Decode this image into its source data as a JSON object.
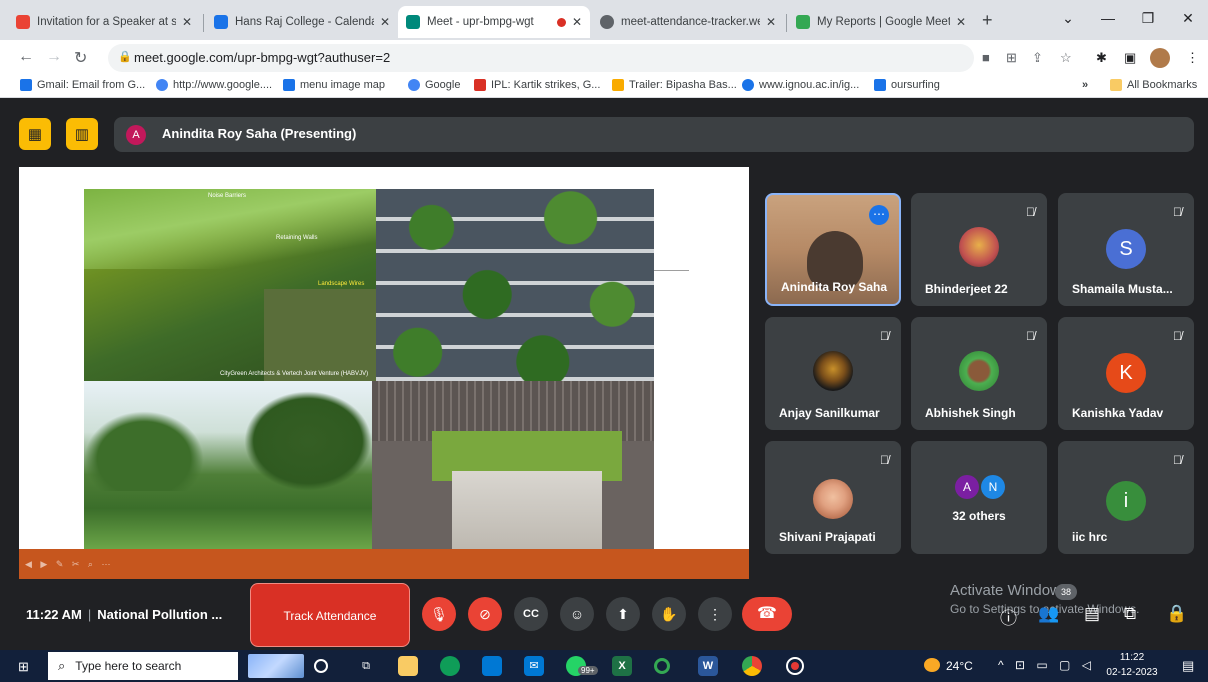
{
  "browser": {
    "tabs": [
      {
        "title": "Invitation for a Speaker at s",
        "favicon_color": "#ea4335",
        "icon": "gmail-icon"
      },
      {
        "title": "Hans Raj College - Calendar",
        "favicon_color": "#1a73e8",
        "icon": "calendar-icon"
      },
      {
        "title": "Meet - upr-bmpg-wgt",
        "favicon_color": "#00897b",
        "icon": "meet-icon",
        "active": true
      },
      {
        "title": "meet-attendance-tracker.we",
        "favicon_color": "#5f6368",
        "icon": "extension-icon"
      },
      {
        "title": "My Reports | Google Meet A",
        "favicon_color": "#34a853",
        "icon": "check-icon"
      }
    ],
    "url": "meet.google.com/upr-bmpg-wgt?authuser=2",
    "bookmarks": [
      {
        "label": "Gmail: Email from G...",
        "color": "#1a73e8"
      },
      {
        "label": "http://www.google....",
        "color": "#4285f4"
      },
      {
        "label": "menu image map",
        "color": "#1a73e8"
      },
      {
        "label": "Google",
        "color": "#4285f4"
      },
      {
        "label": "IPL: Kartik strikes, G...",
        "color": "#d93025"
      },
      {
        "label": "Trailer: Bipasha Bas...",
        "color": "#f9ab00"
      },
      {
        "label": "www.ignou.ac.in/ig...",
        "color": "#1a73e8"
      },
      {
        "label": "oursurfing",
        "color": "#1a73e8"
      }
    ],
    "all_bookmarks": "All Bookmarks"
  },
  "meet": {
    "presenter": {
      "initial": "A",
      "label": "Anindita Roy Saha (Presenting)"
    },
    "slide_caption_1": "Noise Barriers",
    "slide_caption_2": "Retaining Walls",
    "slide_caption_3": "Landscape Wires",
    "slide_caption_4": "CityGreen Architects & Vertech Joint Venture (HABVJV)",
    "participants": [
      {
        "name": "Anindita Roy Saha",
        "kind": "photo",
        "color": "#c9a27e",
        "muted": false
      },
      {
        "name": "Bhinderjeet 22",
        "kind": "photo",
        "color": "#e8b04a",
        "muted": true
      },
      {
        "name": "Shamaila Musta...",
        "kind": "letter",
        "letter": "S",
        "color": "#4a6fd4",
        "muted": true
      },
      {
        "name": "Anjay Sanilkumar",
        "kind": "photo",
        "color": "#7a4e1a",
        "muted": true
      },
      {
        "name": "Abhishek Singh",
        "kind": "photo",
        "color": "#4caf50",
        "muted": true
      },
      {
        "name": "Kanishka Yadav",
        "kind": "letter",
        "letter": "K",
        "color": "#e64a19",
        "muted": true
      },
      {
        "name": "Shivani Prajapati",
        "kind": "photo",
        "color": "#e0a080",
        "muted": true
      },
      {
        "name": "32 others",
        "kind": "group",
        "letters": [
          "A",
          "N"
        ],
        "colors": [
          "#7b1fa2",
          "#1e88e5"
        ],
        "muted": false
      },
      {
        "name": "iic hrc",
        "kind": "letter",
        "letter": "i",
        "color": "#388e3c",
        "muted": true
      }
    ]
  },
  "bottombar": {
    "time": "11:22 AM",
    "meeting_title": "National Pollution ...",
    "track_attendance": "Track Attendance",
    "people_count": "38",
    "watermark_1": "Activate Windows",
    "watermark_2": "Go to Settings to activate Windows."
  },
  "taskbar": {
    "search_placeholder": "Type here to search",
    "temperature": "24°C",
    "time": "11:22",
    "date": "02-12-2023",
    "whatsapp_badge": "99+"
  }
}
